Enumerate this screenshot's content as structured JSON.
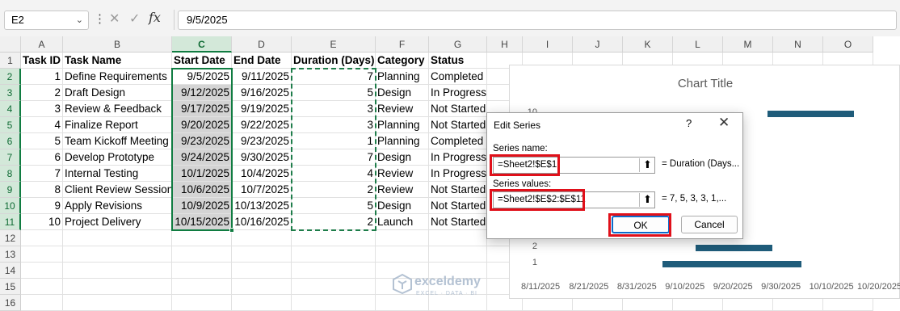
{
  "formula_bar": {
    "name_box": "E2",
    "formula": "9/5/2025",
    "name_box_chevron_icon": "chevron-down-icon",
    "more_icon": "vertical-dots-icon",
    "cancel_icon": "x-icon",
    "enter_icon": "check-icon",
    "fx_label": "fx"
  },
  "columns": [
    "A",
    "B",
    "C",
    "D",
    "E",
    "F",
    "G",
    "H",
    "I",
    "J",
    "K",
    "L",
    "M",
    "N",
    "O"
  ],
  "rows": [
    "1",
    "2",
    "3",
    "4",
    "5",
    "6",
    "7",
    "8",
    "9",
    "10",
    "11",
    "12",
    "13",
    "14",
    "15",
    "16"
  ],
  "table": {
    "headers": [
      "Task ID",
      "Task Name",
      "Start Date",
      "End Date",
      "Duration (Days)",
      "Category",
      "Status"
    ],
    "rows": [
      [
        "1",
        "Define Requirements",
        "9/5/2025",
        "9/11/2025",
        "7",
        "Planning",
        "Completed"
      ],
      [
        "2",
        "Draft Design",
        "9/12/2025",
        "9/16/2025",
        "5",
        "Design",
        "In Progress"
      ],
      [
        "3",
        "Review & Feedback",
        "9/17/2025",
        "9/19/2025",
        "3",
        "Review",
        "Not Started"
      ],
      [
        "4",
        "Finalize Report",
        "9/20/2025",
        "9/22/2025",
        "3",
        "Planning",
        "Not Started"
      ],
      [
        "5",
        "Team Kickoff Meeting",
        "9/23/2025",
        "9/23/2025",
        "1",
        "Planning",
        "Completed"
      ],
      [
        "6",
        "Develop Prototype",
        "9/24/2025",
        "9/30/2025",
        "7",
        "Design",
        "In Progress"
      ],
      [
        "7",
        "Internal Testing",
        "10/1/2025",
        "10/4/2025",
        "4",
        "Review",
        "In Progress"
      ],
      [
        "8",
        "Client Review Session",
        "10/6/2025",
        "10/7/2025",
        "2",
        "Review",
        "Not Started"
      ],
      [
        "9",
        "Apply Revisions",
        "10/9/2025",
        "10/13/2025",
        "5",
        "Design",
        "Not Started"
      ],
      [
        "10",
        "Project Delivery",
        "10/15/2025",
        "10/16/2025",
        "2",
        "Launch",
        "Not Started"
      ]
    ]
  },
  "chart": {
    "title": "Chart Title",
    "bar_color": "#1f5c7a"
  },
  "chart_data": {
    "type": "bar",
    "title": "Chart Title",
    "orientation": "horizontal",
    "categories": [
      "1",
      "2",
      "10"
    ],
    "x_tick_labels": [
      "8/11/2025",
      "8/21/2025",
      "8/31/2025",
      "9/10/2025",
      "9/20/2025",
      "9/30/2025",
      "10/10/2025",
      "10/20/2025"
    ],
    "xlim": [
      "8/11/2025",
      "10/20/2025"
    ],
    "series": [
      {
        "values_start": [
          "9/5/2025",
          "9/12/2025",
          "10/15/2025"
        ],
        "values_end": [
          "10/4/2025",
          "9/28/2025",
          "9/27/2025"
        ]
      }
    ],
    "visible_y_ticks": [
      "10",
      "2",
      "1"
    ]
  },
  "dialog": {
    "title": "Edit Series",
    "help": "?",
    "close_icon": "close-icon",
    "series_name_label": "Series name:",
    "series_name_value": "=Sheet2!$E$1",
    "series_name_result": "= Duration (Days...",
    "series_values_label": "Series values:",
    "series_values_value": "=Sheet2!$E$2:$E$11",
    "series_values_result": "= 7, 5, 3, 3, 1,...",
    "ref_icon": "range-select-icon",
    "ok_label": "OK",
    "cancel_label": "Cancel",
    "highlight_color": "#e0101a"
  },
  "watermark": {
    "name": "exceldemy",
    "tagline": "EXCEL · DATA · BI"
  }
}
